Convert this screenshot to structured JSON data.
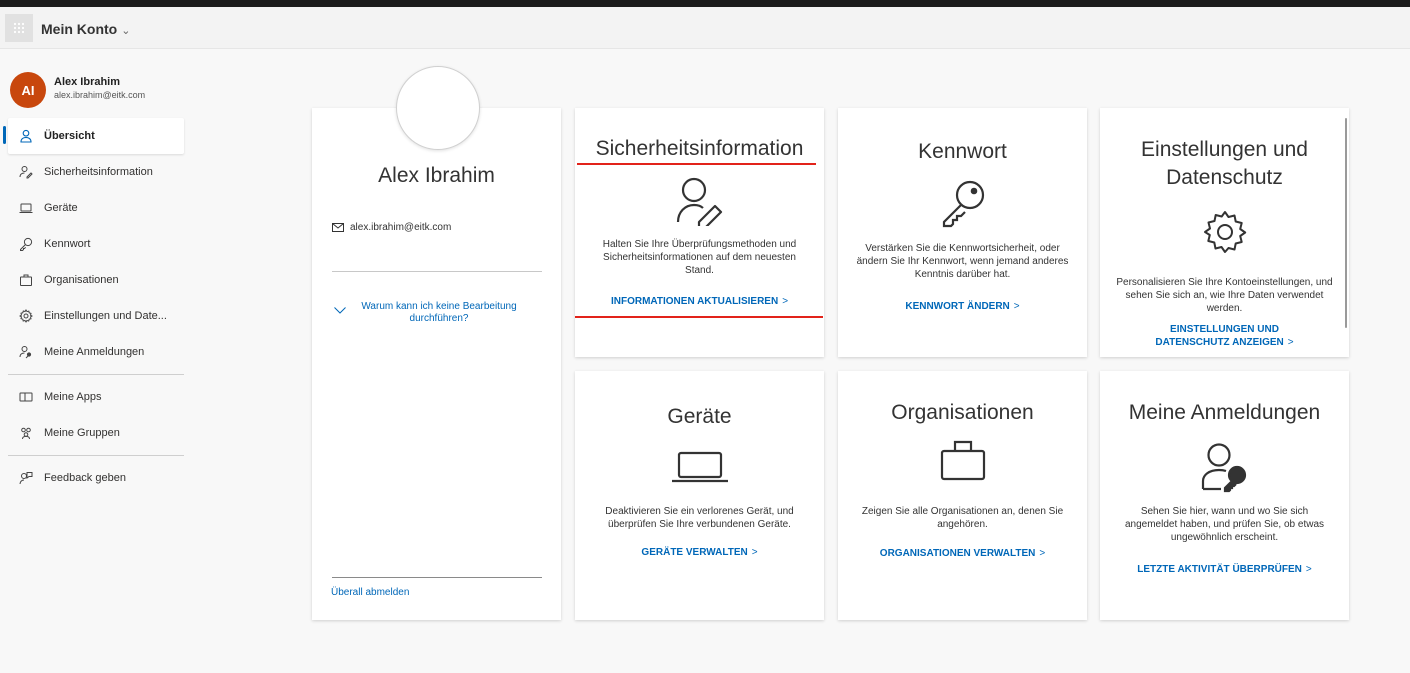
{
  "header": {
    "app_title": "Mein Konto",
    "app_chevron": "⌄",
    "waffle_icon": "waffle-icon"
  },
  "user": {
    "initials": "AI",
    "name": "Alex Ibrahim",
    "email": "alex.ibrahim@eitk.com"
  },
  "sidebar": {
    "items": [
      {
        "label": "Übersicht",
        "icon": "person-icon",
        "active": true
      },
      {
        "label": "Sicherheitsinformation",
        "icon": "security-info-icon"
      },
      {
        "label": "Geräte",
        "icon": "laptop-icon"
      },
      {
        "label": "Kennwort",
        "icon": "key-icon"
      },
      {
        "label": "Organisationen",
        "icon": "briefcase-icon"
      },
      {
        "label": "Einstellungen und Date...",
        "icon": "gear-icon"
      },
      {
        "label": "Meine Anmeldungen",
        "icon": "signin-icon"
      },
      {
        "label": "Meine Apps",
        "icon": "apps-icon"
      },
      {
        "label": "Meine Gruppen",
        "icon": "groups-icon"
      },
      {
        "label": "Feedback geben",
        "icon": "feedback-icon"
      }
    ]
  },
  "profile": {
    "name": "Alex Ibrahim",
    "email": "alex.ibrahim@eitk.com",
    "why_link": "Warum kann ich keine Bearbeitung durchführen?",
    "signout": "Überall abmelden"
  },
  "tiles": {
    "security": {
      "title": "Sicherheitsinformation",
      "desc": "Halten Sie Ihre Überprüfungsmethoden und Sicherheitsinformationen auf dem neuesten Stand.",
      "link": "INFORMATIONEN AKTUALISIEREN",
      "chevron": ">"
    },
    "password": {
      "title": "Kennwort",
      "desc": "Verstärken Sie die Kennwortsicherheit, oder ändern Sie Ihr Kennwort, wenn jemand anderes Kenntnis darüber hat.",
      "link": "KENNWORT ÄNDERN",
      "chevron": ">"
    },
    "settings": {
      "title": "Einstellungen und Datenschutz",
      "desc": "Personalisieren Sie Ihre Kontoeinstellungen, und sehen Sie sich an, wie Ihre Daten verwendet werden.",
      "link": "EINSTELLUNGEN UND DATENSCHUTZ ANZEIGEN",
      "chevron": ">"
    },
    "devices": {
      "title": "Geräte",
      "desc": "Deaktivieren Sie ein verlorenes Gerät, und überprüfen Sie Ihre verbundenen Geräte.",
      "link": "GERÄTE VERWALTEN",
      "chevron": ">"
    },
    "organizations": {
      "title": "Organisationen",
      "desc": "Zeigen Sie alle Organisationen an, denen Sie angehören.",
      "link": "ORGANISATIONEN VERWALTEN",
      "chevron": ">"
    },
    "signins": {
      "title": "Meine Anmeldungen",
      "desc": "Sehen Sie hier, wann und wo Sie sich angemeldet haben, und prüfen Sie, ob etwas ungewöhnlich erscheint.",
      "link": "LETZTE AKTIVITÄT ÜBERPRÜFEN",
      "chevron": ">"
    }
  },
  "colors": {
    "accent": "#0067b8",
    "avatar": "#c8470d",
    "annotation": "#e2231a"
  }
}
